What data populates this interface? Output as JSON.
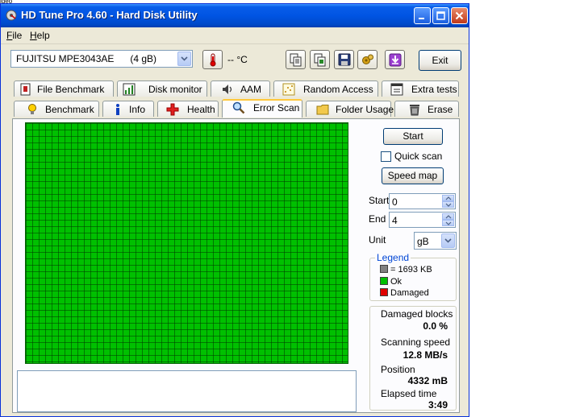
{
  "top_fragment": "ideo",
  "window": {
    "title": "HD Tune Pro 4.60 - Hard Disk Utility"
  },
  "menu": {
    "file": "File",
    "help": "Help"
  },
  "toolbar": {
    "drive_select": "FUJITSU MPE3043AE      (4 gB)",
    "temperature": "-- °C",
    "exit_label": "Exit",
    "icons": [
      "thermometer-icon",
      "copy-text-icon",
      "copy-screenshot-icon",
      "save-icon",
      "options-icon",
      "download-icon"
    ]
  },
  "tabs": {
    "row1": [
      {
        "label": "File Benchmark",
        "icon": "file-benchmark-icon"
      },
      {
        "label": "Disk monitor",
        "icon": "disk-monitor-icon"
      },
      {
        "label": "AAM",
        "icon": "speaker-icon"
      },
      {
        "label": "Random Access",
        "icon": "random-access-icon"
      },
      {
        "label": "Extra tests",
        "icon": "extra-tests-icon"
      }
    ],
    "row2": [
      {
        "label": "Benchmark",
        "icon": "lightbulb-icon"
      },
      {
        "label": "Info",
        "icon": "info-icon"
      },
      {
        "label": "Health",
        "icon": "health-cross-icon"
      },
      {
        "label": "Error Scan",
        "icon": "magnifier-icon",
        "active": true
      },
      {
        "label": "Folder Usage",
        "icon": "folder-icon"
      },
      {
        "label": "Erase",
        "icon": "trash-icon"
      }
    ]
  },
  "scan": {
    "start_label": "Start",
    "quick_scan_label": "Quick scan",
    "quick_scan_checked": false,
    "speed_map_label": "Speed map",
    "start_field_label": "Start",
    "start_value": "0",
    "end_field_label": "End",
    "end_value": "4",
    "unit_label": "Unit",
    "unit_value": "gB",
    "block_status": "all-ok",
    "legend": {
      "title": "Legend",
      "block_size": "= 1693 KB",
      "ok": "Ok",
      "damaged": "Damaged",
      "colors": {
        "block": "#808080",
        "ok": "#00c000",
        "damaged": "#e00000"
      }
    },
    "stats": {
      "damaged_blocks_label": "Damaged blocks",
      "damaged_blocks_value": "0.0 %",
      "scanning_speed_label": "Scanning speed",
      "scanning_speed_value": "12.8 MB/s",
      "position_label": "Position",
      "position_value": "4332 mB",
      "elapsed_label": "Elapsed time",
      "elapsed_value": "3:49"
    }
  },
  "colors": {
    "titlebar": "#0054e3",
    "window_bg": "#ece9d8",
    "ok_block": "#00c000",
    "active_tab_highlight": "#ffc83c"
  }
}
